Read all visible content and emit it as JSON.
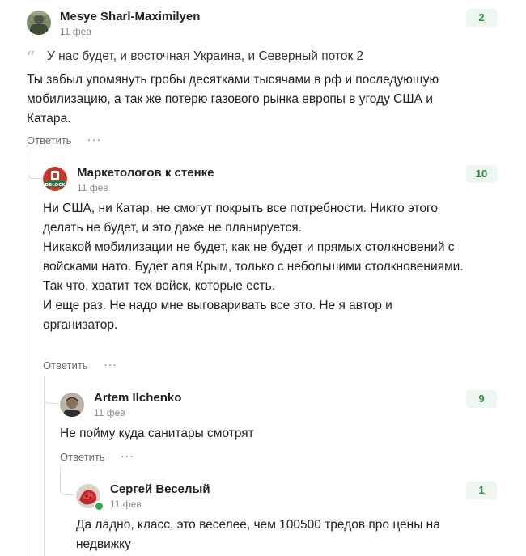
{
  "comments": [
    {
      "author": "Mesye Sharl-Maximilyen",
      "date": "11 фев",
      "rating": "2",
      "quote": "У нас будет, и восточная Украина, и Северный поток 2",
      "text": "Ты забыл упомянуть гробы десятками тысячами в рф и последующую мобилизацию, а так же потерю газового рынка европы в угоду США и Катара.",
      "reply_label": "Ответить",
      "more_label": "···"
    },
    {
      "author": "Маркетологов к стенке",
      "date": "11 фев",
      "rating": "10",
      "avatar_text": "DBLOCK",
      "text": "Ни США, ни Катар, не смогут покрыть все потребности. Никто этого делать не будет, и это даже не планируется.\nНикакой мобилизации не будет, как не будет и прямых столкновений с войсками нато. Будет аля Крым, только с небольшими столкновениями. Так что, хватит тех войск, которые есть.\nИ еще раз. Не надо мне выговаривать все это. Не я автор и организатор.",
      "reply_label": "Ответить",
      "more_label": "···"
    },
    {
      "author": "Artem Ilchenko",
      "date": "11 фев",
      "rating": "9",
      "text": "Не пойму куда санитары смотрят",
      "reply_label": "Ответить",
      "more_label": "···"
    },
    {
      "author": "Сергей Веселый",
      "date": "11 фев",
      "rating": "1",
      "text": "Да ладно, класс, это веселее, чем 100500 тредов про цены на недвижку"
    }
  ],
  "colors": {
    "rating_bg": "#edf7ef",
    "rating_text": "#2e8b4a",
    "online": "#2fa84f"
  }
}
